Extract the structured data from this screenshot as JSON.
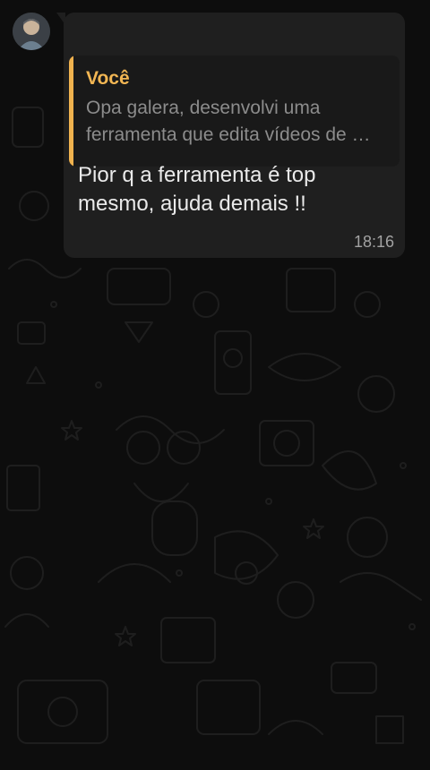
{
  "message": {
    "quoted_author": "Você",
    "quoted_text": "Opa galera, desenvolvi uma ferramenta que edita vídeos de …",
    "text": "Pior q a ferramenta é top mesmo, ajuda demais !!",
    "time": "18:16"
  },
  "colors": {
    "background": "#0d0d0d",
    "bubble": "#1f1f1f",
    "quote_accent": "#f0b24e",
    "text": "#eaeaea",
    "muted_text": "#8c8c8c"
  },
  "icons": [
    "user-avatar",
    "chat-wallpaper-doodles"
  ]
}
